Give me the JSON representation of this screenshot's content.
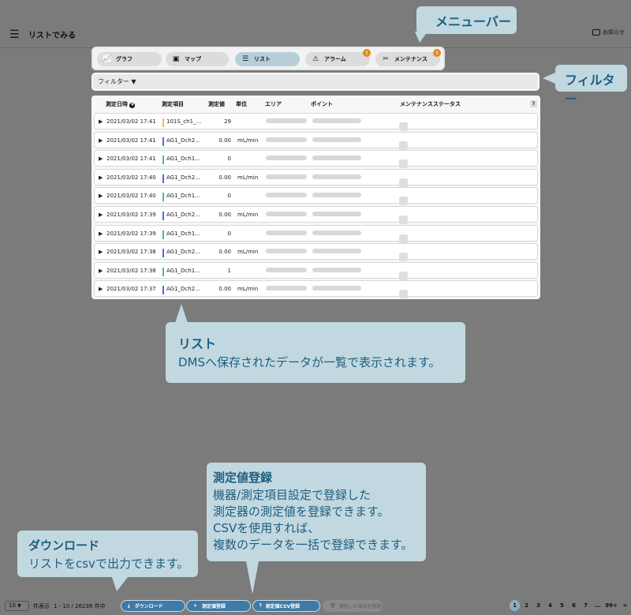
{
  "header": {
    "title": "リストでみる",
    "notice_label": "お知らせ"
  },
  "menubar": {
    "tabs": [
      {
        "label": "グラフ",
        "icon": "chart-line-icon",
        "glyph": "📈",
        "active": false,
        "badge": ""
      },
      {
        "label": "マップ",
        "icon": "map-icon",
        "glyph": "▣",
        "active": false,
        "badge": ""
      },
      {
        "label": "リスト",
        "icon": "list-icon",
        "glyph": "☰",
        "active": true,
        "badge": ""
      },
      {
        "label": "アラーム",
        "icon": "warning-icon",
        "glyph": "⚠",
        "active": false,
        "badge": "!"
      },
      {
        "label": "メンテナンス",
        "icon": "tools-icon",
        "glyph": "✂",
        "active": false,
        "badge": "!"
      }
    ]
  },
  "filter": {
    "label": "フィルター ▼"
  },
  "list": {
    "columns": [
      "測定日時",
      "測定項目",
      "測定値",
      "単位",
      "エリア",
      "ポイント",
      "メンテナンスステータス"
    ],
    "help": "?",
    "rows": [
      {
        "date": "2021/03/02 17:41",
        "item": "101S_ch1_...",
        "value": "29",
        "unit": "",
        "color": "#e8c24a"
      },
      {
        "date": "2021/03/02 17:41",
        "item": "AG1_Dch2...",
        "value": "0.00",
        "unit": "mL/min",
        "color": "#4a6fd6"
      },
      {
        "date": "2021/03/02 17:41",
        "item": "AG1_Dch1...",
        "value": "0",
        "unit": "",
        "color": "#4ab8a0"
      },
      {
        "date": "2021/03/02 17:40",
        "item": "AG1_Dch2...",
        "value": "0.00",
        "unit": "mL/min",
        "color": "#4a6fd6"
      },
      {
        "date": "2021/03/02 17:40",
        "item": "AG1_Dch1...",
        "value": "0",
        "unit": "",
        "color": "#4ab8a0"
      },
      {
        "date": "2021/03/02 17:39",
        "item": "AG1_Dch2...",
        "value": "0.00",
        "unit": "mL/min",
        "color": "#4a6fd6"
      },
      {
        "date": "2021/03/02 17:39",
        "item": "AG1_Dch1...",
        "value": "0",
        "unit": "",
        "color": "#4ab8a0"
      },
      {
        "date": "2021/03/02 17:38",
        "item": "AG1_Dch2...",
        "value": "0.00",
        "unit": "mL/min",
        "color": "#4a6fd6"
      },
      {
        "date": "2021/03/02 17:38",
        "item": "AG1_Dch1...",
        "value": "1",
        "unit": "",
        "color": "#4ab8a0"
      },
      {
        "date": "2021/03/02 17:37",
        "item": "AG1_Dch2...",
        "value": "0.00",
        "unit": "mL/min",
        "color": "#4a6fd6"
      }
    ]
  },
  "callouts": {
    "menubar": "メニューバー",
    "filter": "フィルター",
    "list_title": "リスト",
    "list_body": "DMSへ保存されたデータが一覧で表示されます。",
    "register_title": "測定値登録",
    "register_body": [
      "機器/測定項目設定で登録した",
      "測定器の測定値を登録できます。",
      "CSVを使用すれば、",
      "複数のデータを一括で登録できます。"
    ],
    "download_title": "ダウンロード",
    "download_body": "リストをcsvで出力できます。"
  },
  "footer": {
    "per_page": "10",
    "per_page_label": "件表示",
    "range": "1 - 10 / 26236 件中",
    "buttons": {
      "download": "ダウンロード",
      "register": "測定値登録",
      "register_csv": "測定値CSV登録",
      "delete": "選択した項目を削除"
    },
    "pages": [
      "1",
      "2",
      "3",
      "4",
      "5",
      "6",
      "7",
      "...",
      "99+",
      ">"
    ]
  }
}
